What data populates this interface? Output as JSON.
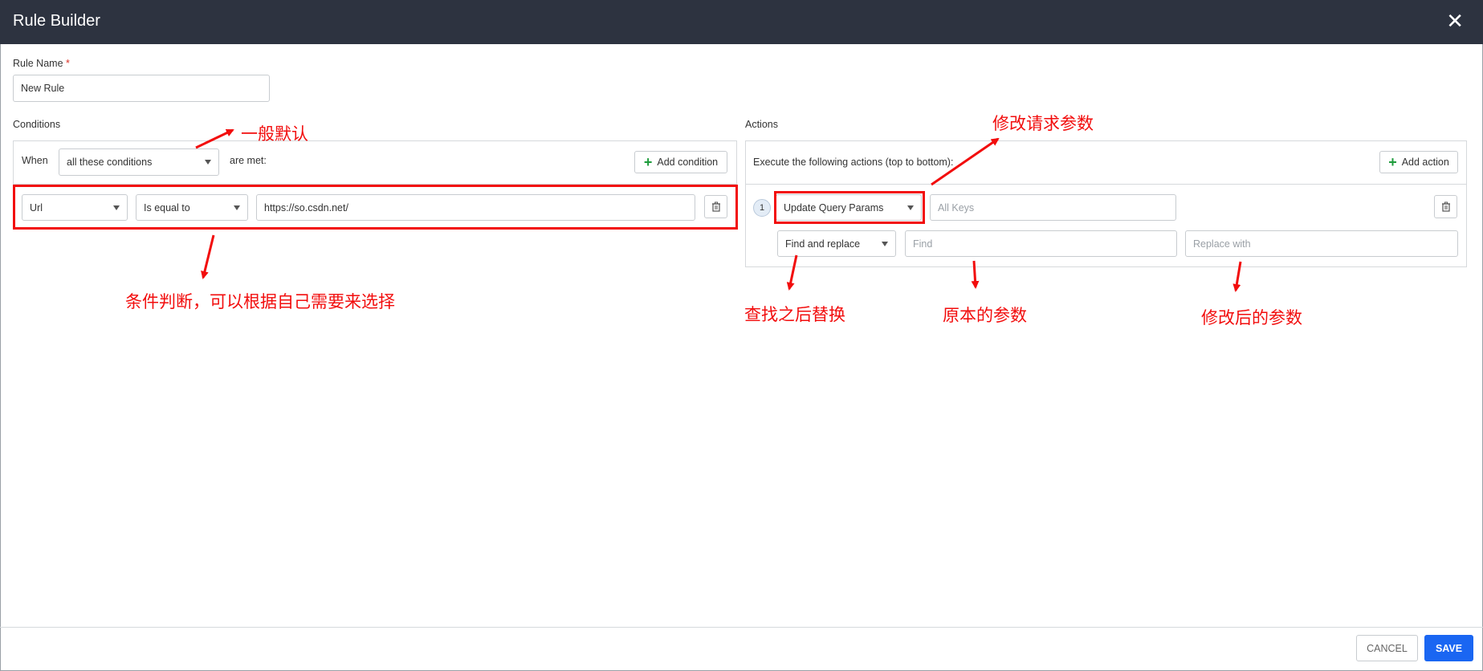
{
  "dialog": {
    "title": "Rule Builder",
    "close_glyph": "✕"
  },
  "rule_name": {
    "label": "Rule Name",
    "required_mark": "*",
    "value": "New Rule"
  },
  "conditions": {
    "label": "Conditions",
    "when_label": "When",
    "when_select": "all these conditions",
    "are_met_label": "are met:",
    "add_condition_label": "Add condition",
    "row": {
      "field": "Url",
      "operator": "Is equal to",
      "value": "https://so.csdn.net/"
    }
  },
  "actions": {
    "label": "Actions",
    "execute_text": "Execute the following actions (top to bottom):",
    "add_action_label": "Add action",
    "row": {
      "index": "1",
      "action_type": "Update Query Params",
      "keys_placeholder": "All Keys",
      "mode": "Find and replace",
      "find_placeholder": "Find",
      "replace_placeholder": "Replace with"
    }
  },
  "annotations": {
    "default_note": "一般默认",
    "condition_note": "条件判断，可以根据自己需要来选择",
    "modify_params_note": "修改请求参数",
    "find_replace_note": "查找之后替换",
    "original_param_note": "原本的参数",
    "modified_param_note": "修改后的参数"
  },
  "footer": {
    "cancel_label": "CANCEL",
    "save_label": "SAVE"
  },
  "colors": {
    "header_bg": "#2d3340",
    "annotation_red": "#f20d0d",
    "save_blue": "#1a66f2",
    "add_green": "#1e9c3c"
  }
}
